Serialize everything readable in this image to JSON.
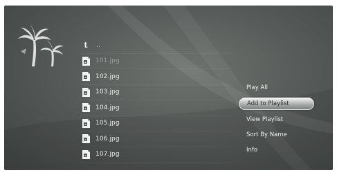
{
  "file_browser": {
    "up_item": {
      "icon": "up-arrow-icon",
      "label": ".."
    },
    "files": [
      {
        "name": "101.jpg",
        "icon": "jpg-file-icon",
        "dim": true
      },
      {
        "name": "102.jpg",
        "icon": "jpg-file-icon",
        "dim": false
      },
      {
        "name": "103.jpg",
        "icon": "jpg-file-icon",
        "dim": false
      },
      {
        "name": "104.jpg",
        "icon": "jpg-file-icon",
        "dim": false
      },
      {
        "name": "105.jpg",
        "icon": "jpg-file-icon",
        "dim": false
      },
      {
        "name": "106.jpg",
        "icon": "jpg-file-icon",
        "dim": false
      },
      {
        "name": "107.jpg",
        "icon": "jpg-file-icon",
        "dim": false
      }
    ]
  },
  "context_menu": {
    "items": [
      {
        "label": "Play All",
        "selected": false
      },
      {
        "label": "Add to Playlist",
        "selected": true
      },
      {
        "label": "View Playlist",
        "selected": false
      },
      {
        "label": "Sort By Name",
        "selected": false
      },
      {
        "label": "Info",
        "selected": false
      }
    ]
  },
  "colors": {
    "background": "#575b59",
    "text": "#eceeed",
    "dim_text": "#9aa09d",
    "highlight": "#d9dbda"
  }
}
